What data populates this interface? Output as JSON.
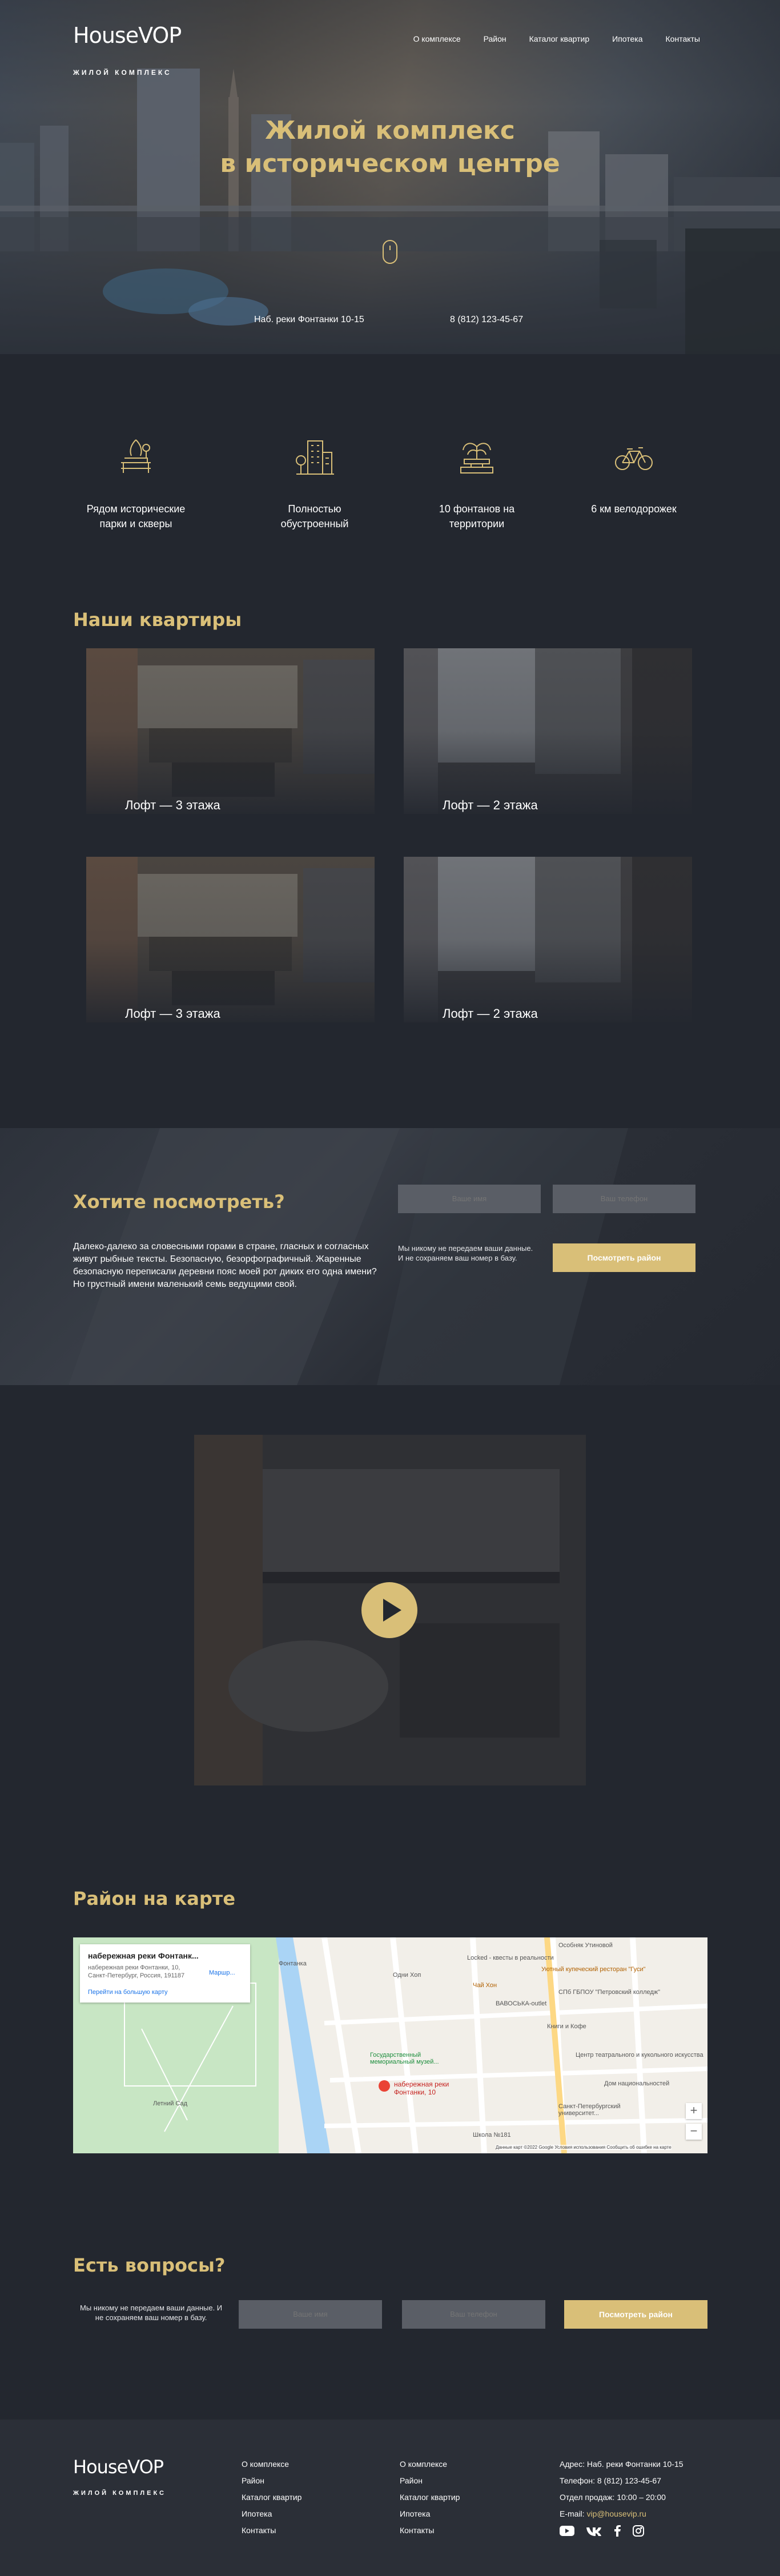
{
  "brand": {
    "logo": "HouseVOP",
    "tagline": "ЖИЛОЙ КОМПЛЕКС"
  },
  "nav": {
    "items": [
      {
        "label": "О комплексе"
      },
      {
        "label": "Район"
      },
      {
        "label": "Каталог квартир"
      },
      {
        "label": "Ипотека"
      },
      {
        "label": "Контакты"
      }
    ]
  },
  "hero": {
    "title_line1": "Жилой комплекс",
    "title_line2": "в историческом центре",
    "address": "Наб. реки Фонтанки 10-15",
    "phone": "8 (812) 123-45-67"
  },
  "features": [
    {
      "icon": "park-bench-icon",
      "line1": "Рядом исторические",
      "line2": "парки и скверы"
    },
    {
      "icon": "buildings-icon",
      "line1": "Полностью",
      "line2": "обустроенный"
    },
    {
      "icon": "fountain-icon",
      "line1": "10 фонтанов на",
      "line2": "территории"
    },
    {
      "icon": "bicycle-icon",
      "line1": "6 км велодорожек",
      "line2": ""
    }
  ],
  "apartments": {
    "title": "Наши квартиры",
    "items": [
      {
        "caption": "Лофт — 3 этажа"
      },
      {
        "caption": "Лофт — 2 этажа"
      },
      {
        "caption": "Лофт — 3 этажа"
      },
      {
        "caption": "Лофт — 2 этажа"
      }
    ]
  },
  "cta": {
    "title": "Хотите посмотреть?",
    "text": "Далеко-далеко за словесными горами в стране, гласных и согласных живут рыбные тексты. Безопасную, безорфографичный. Жаренные безопасную переписали деревни пояс моей рот диких его одна имени? Но грустный имени маленький семь ведущими свой.",
    "name_placeholder": "Ваше имя",
    "phone_placeholder": "Ваш телефон",
    "privacy_line1": "Мы никому не передаем ваши данные.",
    "privacy_line2": "И не сохраняем ваш номер в базу.",
    "button": "Посмотреть район"
  },
  "map_section": {
    "title": "Район на карте",
    "card_title": "набережная реки Фонтанк...",
    "card_address_line1": "набережная реки Фонтанки, 10,",
    "card_address_line2": "Санкт-Петербург, Россия, 191187",
    "card_link": "Перейти на большую карту",
    "card_route": "Маршр...",
    "pin_label_line1": "набережная реки",
    "pin_label_line2": "Фонтанки, 10",
    "labels": {
      "fontanka": "Фонтанка",
      "summer_garden": "Летний Сад",
      "museum_line1": "Государственный",
      "museum_line2": "мемориальный музей...",
      "locked": "Locked - квесты в реальности",
      "gusi": "Уютный купеческий ресторан \"Гуси\"",
      "osobnyak": "Особняк Утиновой",
      "spb_college": "СПб ГБПОУ \"Петровский колледж\"",
      "chai_khon": "Чай Хон",
      "vavoska": "ВАВОСЬКА-outlet",
      "knigi": "Книги и Кофе",
      "teatr": "Центр театрального и кукольного искусства",
      "spbu_line1": "Санкт-Петербургский",
      "spbu_line2": "университет...",
      "shkola": "Школа №181",
      "dom": "Дом национальностей",
      "odni_hops": "Одни Хоп",
      "copyright": "Данные карт ©2022 Google  Условия использования  Сообщить об ошибке на карте"
    }
  },
  "questions": {
    "title": "Есть вопросы?",
    "privacy_line1": "Мы никому не передаем ваши данные. И",
    "privacy_line2": "не сохраняем ваш номер в базу.",
    "name_placeholder": "Ваше имя",
    "phone_placeholder": "Ваш телефон",
    "button": "Посмотреть район"
  },
  "footer": {
    "col1": [
      "О комплексе",
      "Район",
      "Каталог квартир",
      "Ипотека",
      "Контакты"
    ],
    "col2": [
      "О комплексе",
      "Район",
      "Каталог квартир",
      "Ипотека",
      "Контакты"
    ],
    "address": "Адрес:  Наб. реки Фонтанки 10-15",
    "phone": "Телефон:  8 (812) 123-45-67",
    "hours": "Отдел продаж:  10:00 – 20:00",
    "email_label": "E-mail:",
    "email": "vip@housevip.ru",
    "social": [
      "youtube-icon",
      "vk-icon",
      "facebook-icon",
      "instagram-icon"
    ]
  },
  "colors": {
    "background": "#23272f",
    "accent": "#d9bf78",
    "field": "#5a5e66",
    "footer": "#2b2f37"
  }
}
